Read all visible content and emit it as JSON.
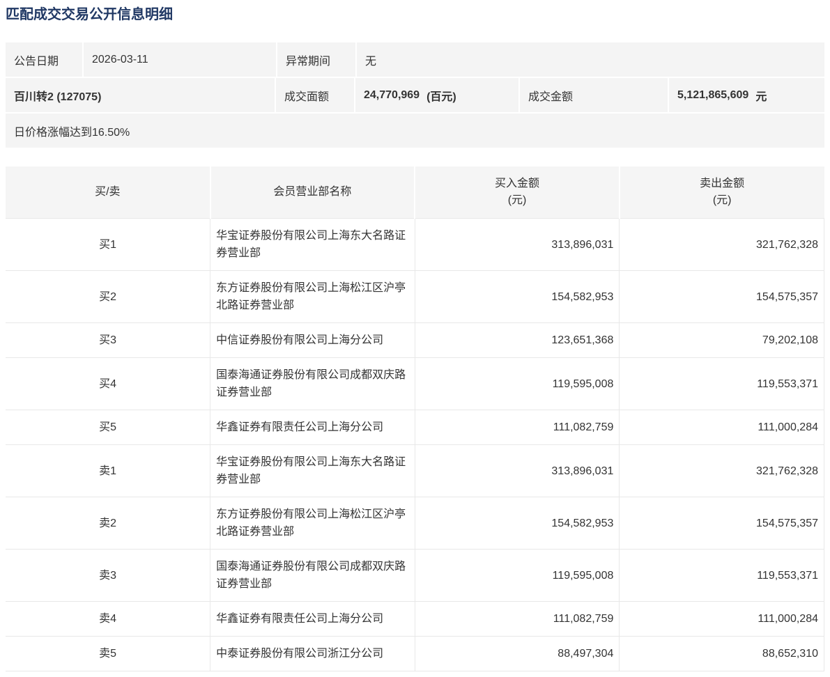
{
  "page": {
    "title": "匹配成交交易公开信息明细"
  },
  "colors": {
    "title_text": "#203864",
    "body_text": "#333333",
    "panel_bg": "#f4f4f4",
    "header_bg": "#f5f5f5",
    "border": "#e8e8e8"
  },
  "info": {
    "announce_date_label": "公告日期",
    "announce_date": "2026-03-11",
    "abnormal_period_label": "异常期间",
    "abnormal_period": "无",
    "security_name": "百川转2 (127075)",
    "face_value_label": "成交面额",
    "face_value": "24,770,969",
    "face_value_unit": "(百元)",
    "turnover_label": "成交金额",
    "turnover": "5,121,865,609",
    "turnover_unit": "元",
    "trigger_note": "日价格涨幅达到16.50%"
  },
  "table": {
    "headers": {
      "side": "买/卖",
      "member": "会员营业部名称",
      "buy_line1": "买入金额",
      "buy_line2": "(元)",
      "sell_line1": "卖出金额",
      "sell_line2": "(元)"
    },
    "rows": [
      {
        "side": "买1",
        "member": "华宝证券股份有限公司上海东大名路证券营业部",
        "buy": "313,896,031",
        "sell": "321,762,328"
      },
      {
        "side": "买2",
        "member": "东方证券股份有限公司上海松江区沪亭北路证券营业部",
        "buy": "154,582,953",
        "sell": "154,575,357"
      },
      {
        "side": "买3",
        "member": "中信证券股份有限公司上海分公司",
        "buy": "123,651,368",
        "sell": "79,202,108"
      },
      {
        "side": "买4",
        "member": "国泰海通证券股份有限公司成都双庆路证券营业部",
        "buy": "119,595,008",
        "sell": "119,553,371"
      },
      {
        "side": "买5",
        "member": "华鑫证券有限责任公司上海分公司",
        "buy": "111,082,759",
        "sell": "111,000,284"
      },
      {
        "side": "卖1",
        "member": "华宝证券股份有限公司上海东大名路证券营业部",
        "buy": "313,896,031",
        "sell": "321,762,328"
      },
      {
        "side": "卖2",
        "member": "东方证券股份有限公司上海松江区沪亭北路证券营业部",
        "buy": "154,582,953",
        "sell": "154,575,357"
      },
      {
        "side": "卖3",
        "member": "国泰海通证券股份有限公司成都双庆路证券营业部",
        "buy": "119,595,008",
        "sell": "119,553,371"
      },
      {
        "side": "卖4",
        "member": "华鑫证券有限责任公司上海分公司",
        "buy": "111,082,759",
        "sell": "111,000,284"
      },
      {
        "side": "卖5",
        "member": "中泰证券股份有限公司浙江分公司",
        "buy": "88,497,304",
        "sell": "88,652,310"
      }
    ]
  }
}
